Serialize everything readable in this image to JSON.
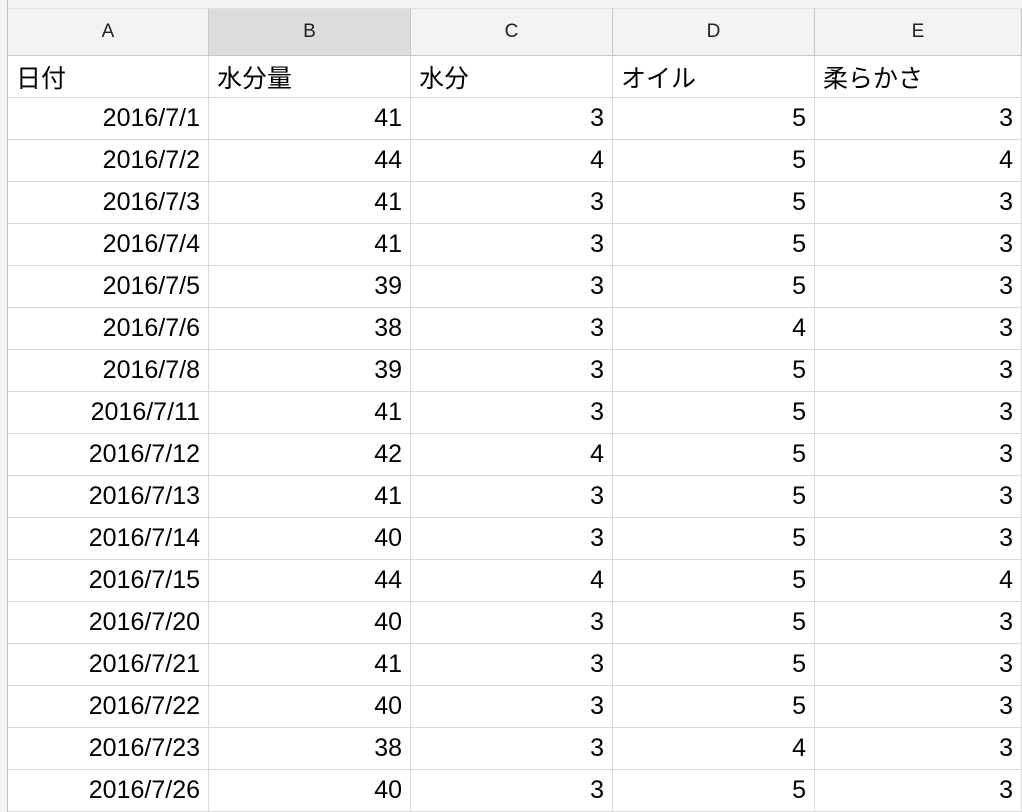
{
  "sheet": {
    "columns": [
      {
        "letter": "A",
        "selected": false
      },
      {
        "letter": "B",
        "selected": true
      },
      {
        "letter": "C",
        "selected": false
      },
      {
        "letter": "D",
        "selected": false
      },
      {
        "letter": "E",
        "selected": false
      }
    ],
    "header_row": [
      "日付",
      "水分量",
      "水分",
      "オイル",
      "柔らかさ"
    ],
    "rows": [
      [
        "2016/7/1",
        "41",
        "3",
        "5",
        "3"
      ],
      [
        "2016/7/2",
        "44",
        "4",
        "5",
        "4"
      ],
      [
        "2016/7/3",
        "41",
        "3",
        "5",
        "3"
      ],
      [
        "2016/7/4",
        "41",
        "3",
        "5",
        "3"
      ],
      [
        "2016/7/5",
        "39",
        "3",
        "5",
        "3"
      ],
      [
        "2016/7/6",
        "38",
        "3",
        "4",
        "3"
      ],
      [
        "2016/7/8",
        "39",
        "3",
        "5",
        "3"
      ],
      [
        "2016/7/11",
        "41",
        "3",
        "5",
        "3"
      ],
      [
        "2016/7/12",
        "42",
        "4",
        "5",
        "3"
      ],
      [
        "2016/7/13",
        "41",
        "3",
        "5",
        "3"
      ],
      [
        "2016/7/14",
        "40",
        "3",
        "5",
        "3"
      ],
      [
        "2016/7/15",
        "44",
        "4",
        "5",
        "4"
      ],
      [
        "2016/7/20",
        "40",
        "3",
        "5",
        "3"
      ],
      [
        "2016/7/21",
        "41",
        "3",
        "5",
        "3"
      ],
      [
        "2016/7/22",
        "40",
        "3",
        "5",
        "3"
      ],
      [
        "2016/7/23",
        "38",
        "3",
        "4",
        "3"
      ],
      [
        "2016/7/26",
        "40",
        "3",
        "5",
        "3"
      ]
    ]
  },
  "colors": {
    "header_bg": "#f3f3f3",
    "header_selected_bg": "#dcdcdc",
    "grid_line": "#d9d9d9",
    "text": "#000000"
  }
}
